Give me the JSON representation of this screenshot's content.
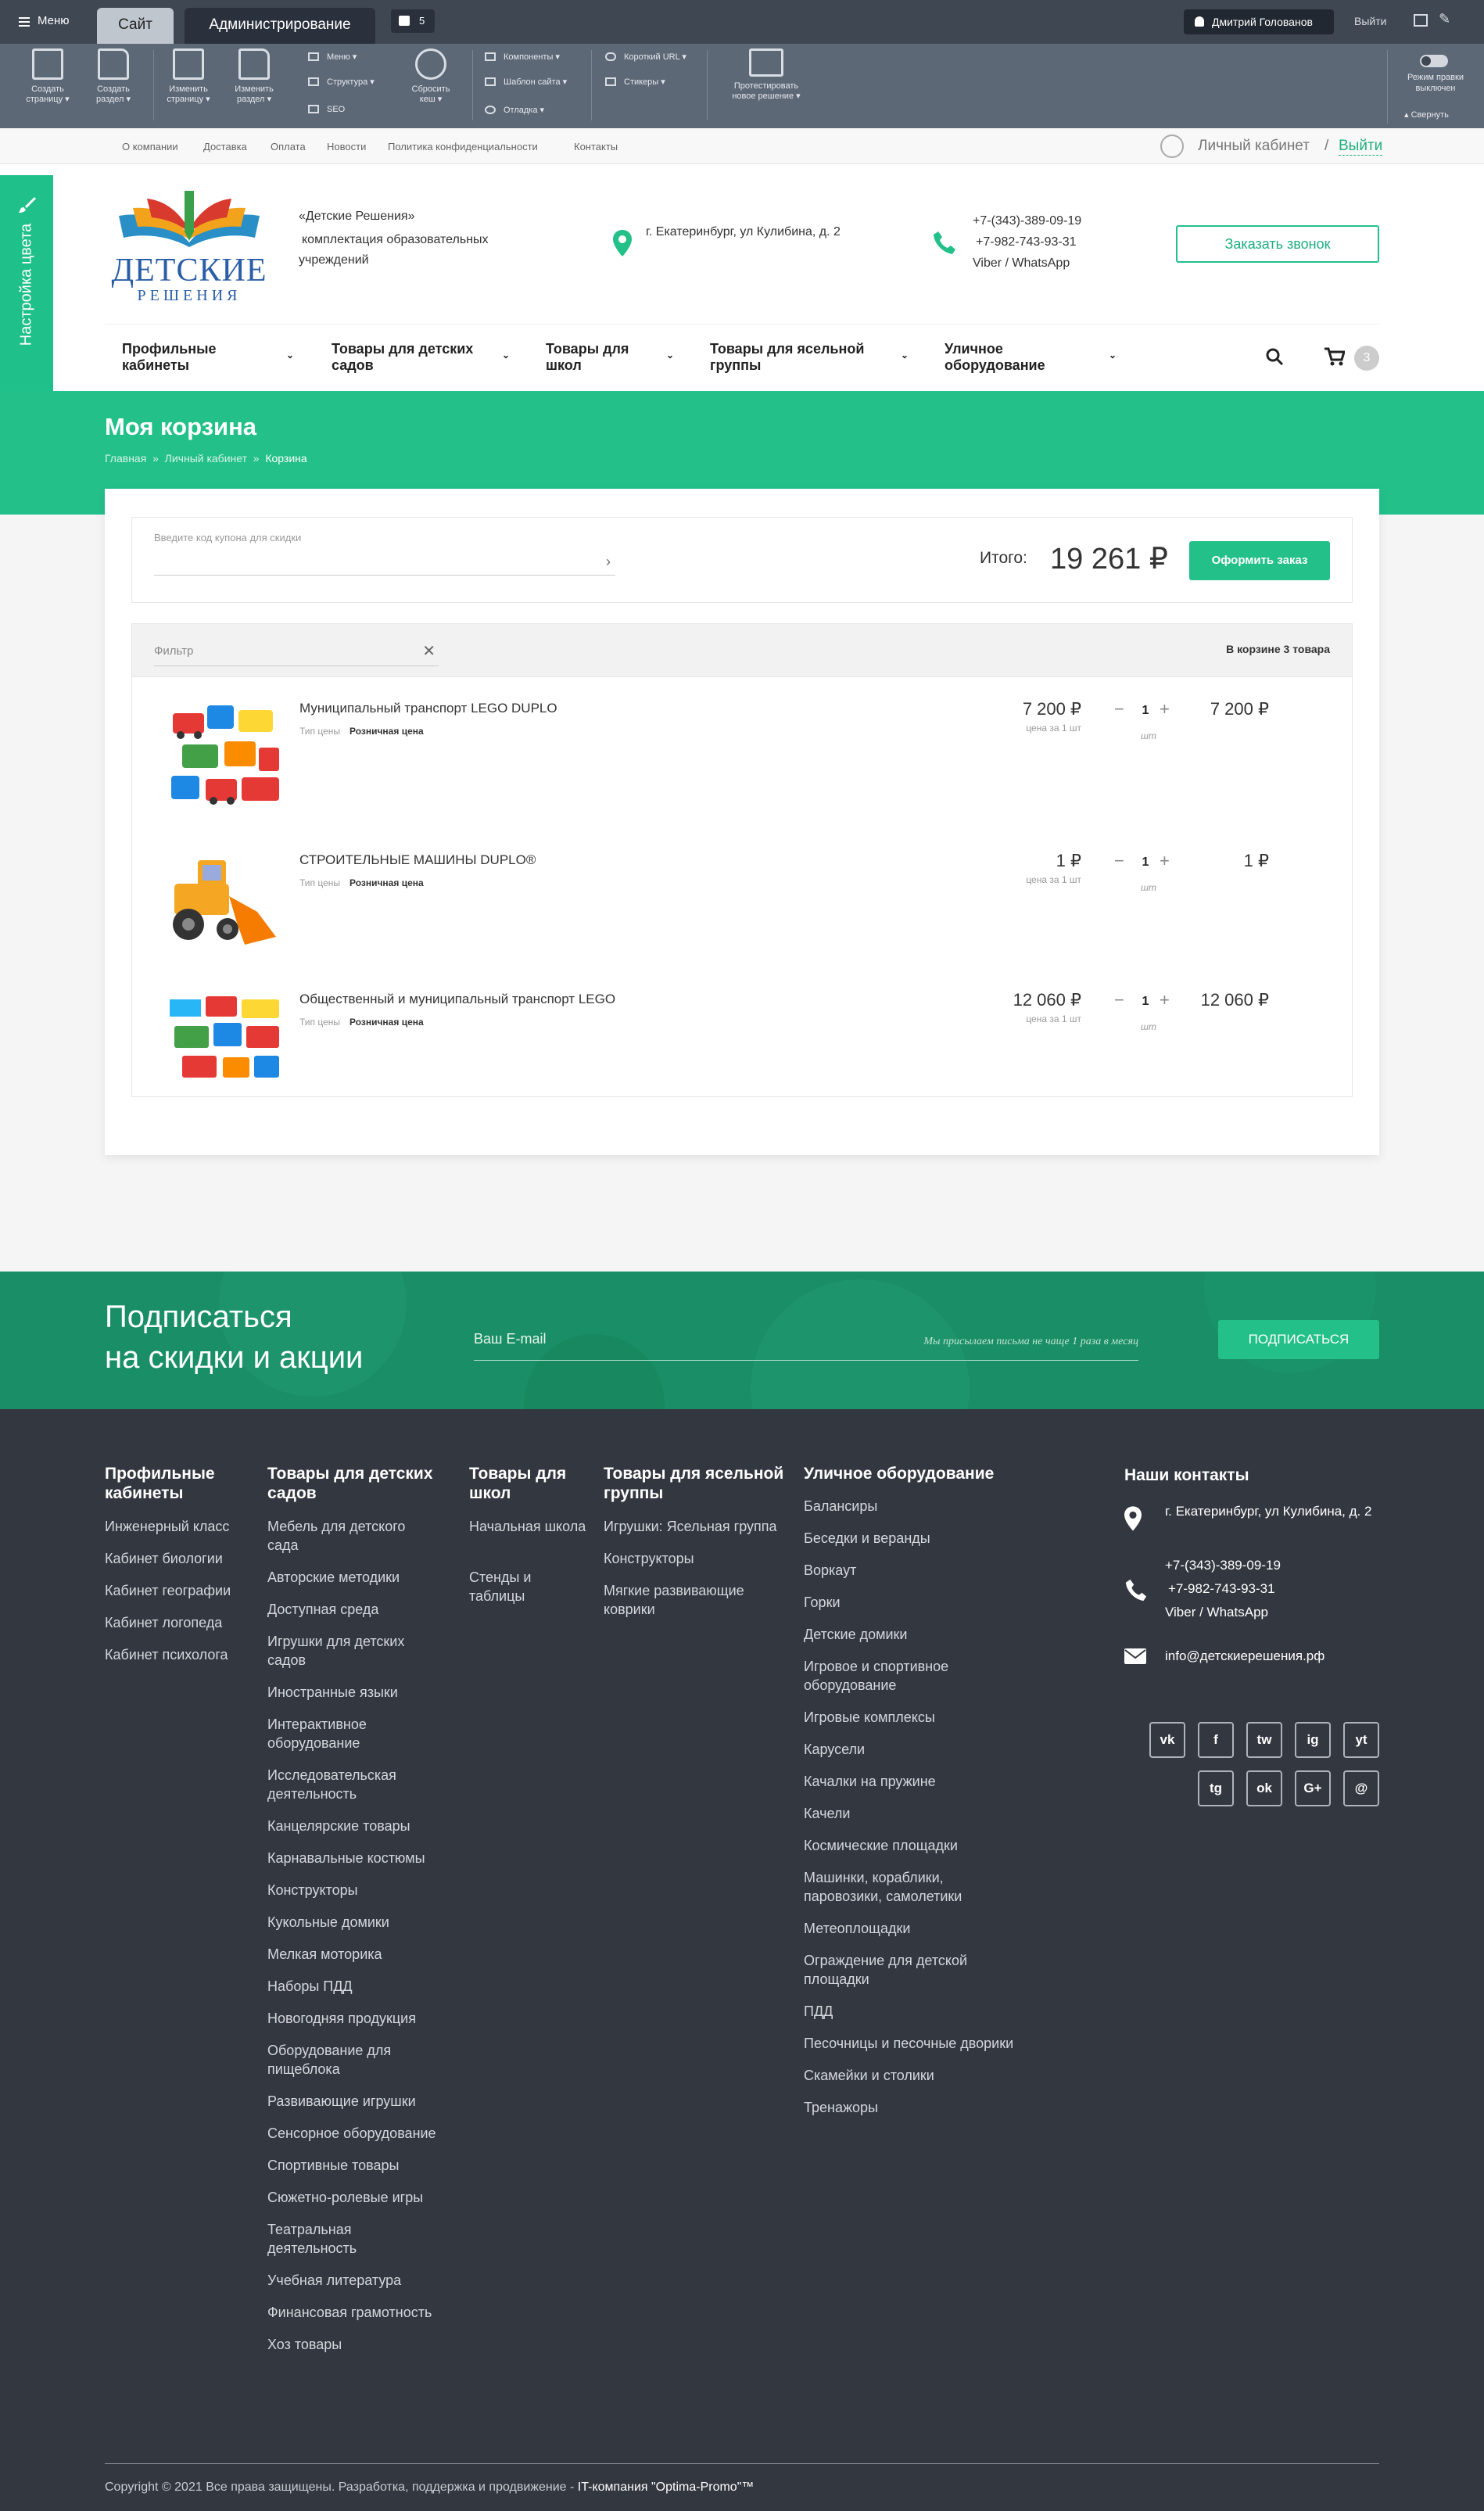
{
  "admin": {
    "menu": "Меню",
    "tab_site": "Сайт",
    "tab_admin": "Администрирование",
    "notifications": "5",
    "user": "Дмитрий Голованов",
    "logout": "Выйти",
    "tools": [
      {
        "label1": "Создать",
        "label2": "страницу"
      },
      {
        "label1": "Создать",
        "label2": "раздел"
      },
      {
        "label1": "Изменить",
        "label2": "страницу"
      },
      {
        "label1": "Изменить",
        "label2": "раздел"
      },
      {
        "label1": "Сбросить",
        "label2": "кеш"
      }
    ],
    "small": {
      "menu": "Меню",
      "structure": "Структура",
      "seo": "SEO",
      "components": "Компоненты",
      "template": "Шаблон сайта",
      "debug": "Отладка",
      "short_url": "Короткий URL",
      "stickers": "Стикеры"
    },
    "test": {
      "l1": "Протестировать",
      "l2": "новое решение"
    },
    "edit_mode": {
      "l1": "Режим правки",
      "l2": "выключен"
    },
    "collapse": "Свернуть"
  },
  "topnav": [
    "О компании",
    "Доставка",
    "Оплата",
    "Новости",
    "Политика конфиденциальности",
    "Контакты"
  ],
  "account": {
    "label": "Личный кабинет",
    "sep": "/",
    "logout": "Выйти"
  },
  "side_tab": "Настройка цвета",
  "header": {
    "logo1": "ДЕТСКИЕ",
    "logo2": "РЕШЕНИЯ",
    "brand": "«Детские Решения»",
    "brand_desc": "комплектация образовательных учреждений",
    "address": "г. Екатеринбург, ул Кулибина, д. 2",
    "phone1": "+7-(343)-389-09-19",
    "phone2": "+7-982-743-93-31",
    "messengers": "Viber / WhatsApp",
    "callback": "Заказать звонок"
  },
  "nav": [
    "Профильные кабинеты",
    "Товары для детских садов",
    "Товары для школ",
    "Товары для ясельной группы",
    "Уличное оборудование"
  ],
  "cart_count": "3",
  "page": {
    "title": "Моя корзина",
    "crumbs": [
      "Главная",
      "Личный кабинет",
      "Корзина"
    ],
    "sep": "»"
  },
  "cart": {
    "coupon_placeholder": "Введите код купона для скидки",
    "total_label": "Итого:",
    "total": "19 261 ₽",
    "checkout": "Оформить заказ",
    "filter_placeholder": "Фильтр",
    "in_cart": "В корзине 3 товара",
    "price_type_label": "Тип цены",
    "unit_price_label": "цена за 1 шт",
    "unit": "шт",
    "items": [
      {
        "name": "Муниципальный транспорт LEGO DUPLO",
        "price_type": "Розничная цена",
        "price": "7 200 ₽",
        "qty": "1",
        "sum": "7 200 ₽",
        "show_unit_label": true
      },
      {
        "name": "СТРОИТЕЛЬНЫЕ МАШИНЫ DUPLO®",
        "price_type": "Розничная цена",
        "price": "1 ₽",
        "qty": "1",
        "sum": "1 ₽",
        "show_unit_label": true
      },
      {
        "name": "Общественный и муниципальный транспорт LEGO",
        "price_type": "Розничная цена",
        "price": "12 060 ₽",
        "qty": "1",
        "sum": "12 060 ₽",
        "show_unit_label": true
      }
    ]
  },
  "subscribe": {
    "title1": "Подписаться",
    "title2": "на скидки и акции",
    "placeholder": "Ваш E-mail",
    "note": "Мы присылаем письма не чаще 1 раза в месяц",
    "button": "ПОДПИСАТЬСЯ"
  },
  "footer": {
    "cols": [
      {
        "title": "Профильные кабинеты",
        "links": [
          "Инженерный класс",
          "Кабинет биологии",
          "Кабинет географии",
          "Кабинет логопеда",
          "Кабинет психолога"
        ]
      },
      {
        "title": "Товары для детских садов",
        "links": [
          "Мебель для детского сада",
          "Авторские методики",
          "Доступная среда",
          "Игрушки для детских садов",
          "Иностранные языки",
          "Интерактивное оборудование",
          "Исследовательская деятельность",
          "Канцелярские товары",
          "Карнавальные костюмы",
          "Конструкторы",
          "Кукольные домики",
          "Мелкая моторика",
          "Наборы ПДД",
          "Новогодняя продукция",
          "Оборудование для пищеблока",
          "Развивающие игрушки",
          "Сенсорное оборудование",
          "Спортивные товары",
          "Сюжетно-ролевые игры",
          "Театральная деятельность",
          "Учебная литература",
          "Финансовая грамотность",
          "Хоз товары"
        ]
      },
      {
        "title": "Товары для школ",
        "links": [
          "Начальная школа",
          "Стенды и таблицы"
        ]
      },
      {
        "title": "Товары для ясельной группы",
        "links": [
          "Игрушки: Ясельная группа",
          "Конструкторы",
          "Мягкие развивающие коврики"
        ]
      },
      {
        "title": "Уличное оборудование",
        "links": [
          "Балансиры",
          "Беседки и веранды",
          "Воркаут",
          "Горки",
          "Детские домики",
          "Игровое и спортивное оборудование",
          "Игровые комплексы",
          "Карусели",
          "Качалки на пружине",
          "Качели",
          "Космические площадки",
          "Машинки, кораблики, паровозики, самолетики",
          "Метеоплощадки",
          "Ограждение для детской площадки",
          "ПДД",
          "Песочницы и песочные дворики",
          "Скамейки и столики",
          "Тренажоры"
        ]
      }
    ],
    "contacts": {
      "title": "Наши контакты",
      "address": "г. Екатеринбург, ул Кулибина, д. 2",
      "phone1": "+7-(343)-389-09-19",
      "phone2": "+7-982-743-93-31",
      "messengers": "Viber / WhatsApp",
      "email": "info@детскиерешения.рф"
    },
    "social": [
      "vk",
      "f",
      "tw",
      "ig",
      "yt",
      "tg",
      "ok",
      "G+",
      "@"
    ],
    "copyright": "Copyright © 2021 Все права защищены. Разработка, поддержка и продвижение - ",
    "company": "IT-компания \"Optima-Promo\"™"
  },
  "colors": {
    "accent": "#23c08a",
    "footer_bg": "#333840",
    "admin_bg": "#5d6877"
  }
}
